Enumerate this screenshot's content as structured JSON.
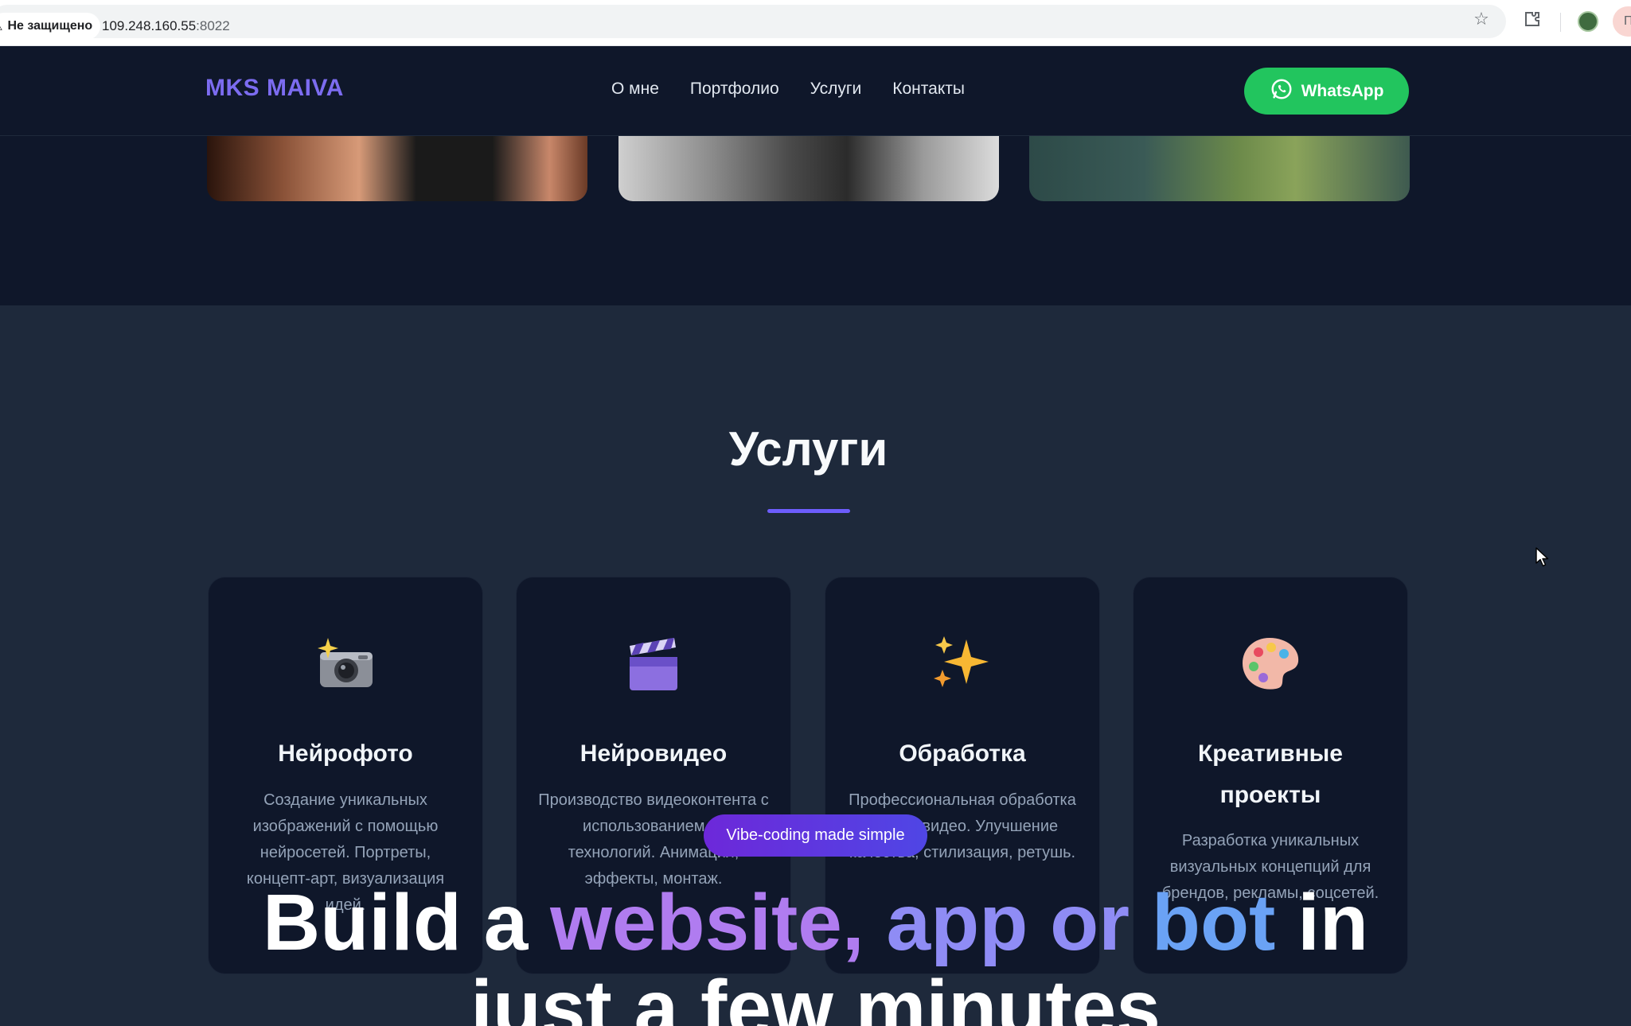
{
  "browser": {
    "security_label": "Не защищено",
    "url_host": "109.248.160.55",
    "url_port": ":8022",
    "menu_chip_label": "П"
  },
  "header": {
    "logo": "MKS MAIVA",
    "nav": [
      "О мне",
      "Портфолио",
      "Услуги",
      "Контакты"
    ],
    "whatsapp_label": "WhatsApp"
  },
  "services": {
    "title": "Услуги",
    "cards": [
      {
        "icon": "camera-with-flash-icon",
        "title": "Нейрофото",
        "desc": "Создание уникальных изображений с помощью нейросетей. Портреты, концепт-арт, визуализация идей."
      },
      {
        "icon": "clapper-board-icon",
        "title": "Нейровидео",
        "desc": "Производство видеоконтента с использованием AI технологий. Анимация, эффекты, монтаж."
      },
      {
        "icon": "sparkles-icon",
        "title": "Обработка",
        "desc": "Профессиональная обработка фото и видео. Улучшение качества, стилизация, ретушь."
      },
      {
        "icon": "artist-palette-icon",
        "title": "Креативные проекты",
        "desc": "Разработка уникальных визуальных концепций для брендов, рекламы, соцсетей."
      }
    ]
  },
  "overlay": {
    "badge": "Vibe-coding made simple",
    "promo_word_1": "Build a ",
    "promo_word_2": "website,",
    "promo_word_3": " app or",
    "promo_word_4": " bot",
    "promo_word_5": " in",
    "promo_line_2": "just a few minutes"
  },
  "colors": {
    "accent": "#6d5dfc",
    "whatsapp": "#22c55e",
    "page_bg": "#1e293b",
    "card_bg": "#0f172a"
  }
}
